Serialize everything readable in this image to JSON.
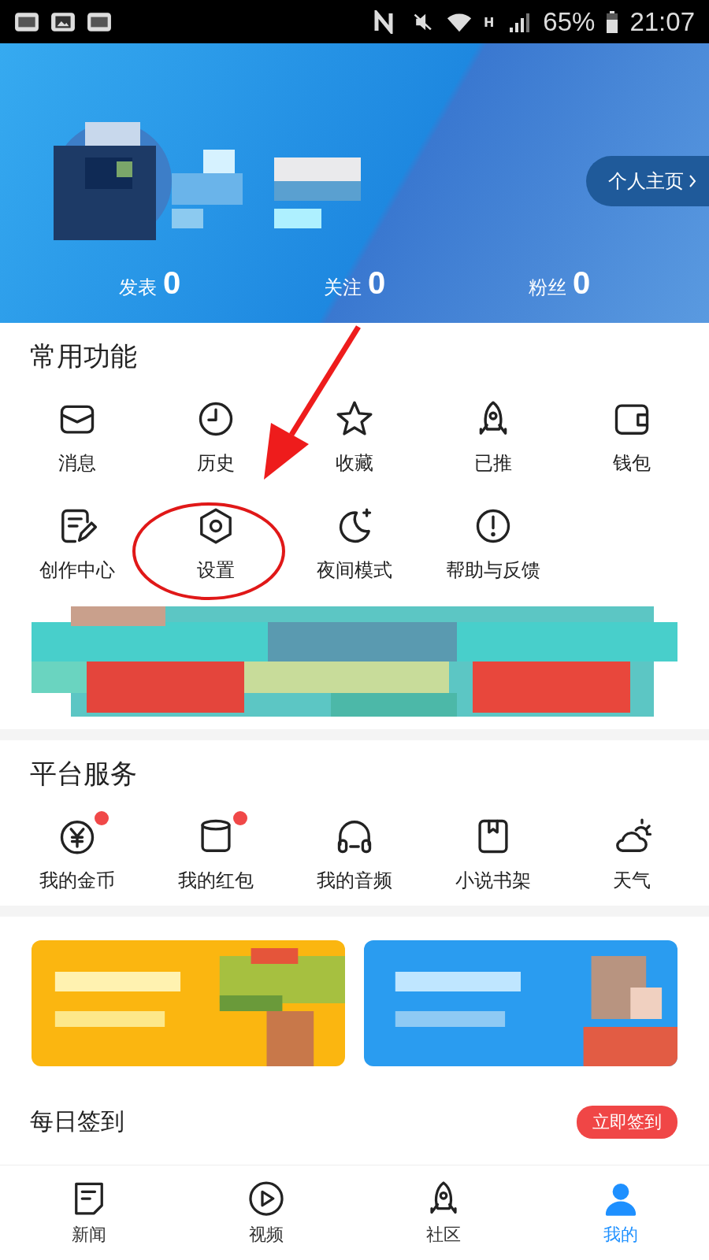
{
  "status_bar": {
    "network": "H",
    "battery": "65%",
    "time": "21:07"
  },
  "profile": {
    "homepage_button": "个人主页",
    "stats": [
      {
        "label": "发表",
        "value": "0"
      },
      {
        "label": "关注",
        "value": "0"
      },
      {
        "label": "粉丝",
        "value": "0"
      }
    ]
  },
  "common_functions": {
    "title": "常用功能",
    "items": [
      {
        "label": "消息"
      },
      {
        "label": "历史"
      },
      {
        "label": "收藏"
      },
      {
        "label": "已推"
      },
      {
        "label": "钱包"
      },
      {
        "label": "创作中心"
      },
      {
        "label": "设置"
      },
      {
        "label": "夜间模式"
      },
      {
        "label": "帮助与反馈"
      }
    ]
  },
  "platform_services": {
    "title": "平台服务",
    "items": [
      {
        "label": "我的金币",
        "badge": true
      },
      {
        "label": "我的红包",
        "badge": true
      },
      {
        "label": "我的音频",
        "badge": false
      },
      {
        "label": "小说书架",
        "badge": false
      },
      {
        "label": "天气",
        "badge": false
      }
    ]
  },
  "daily_checkin": {
    "title": "每日签到",
    "button": "立即签到"
  },
  "bottom_nav": [
    {
      "label": "新闻",
      "selected": false
    },
    {
      "label": "视频",
      "selected": false
    },
    {
      "label": "社区",
      "selected": false
    },
    {
      "label": "我的",
      "selected": true
    }
  ]
}
